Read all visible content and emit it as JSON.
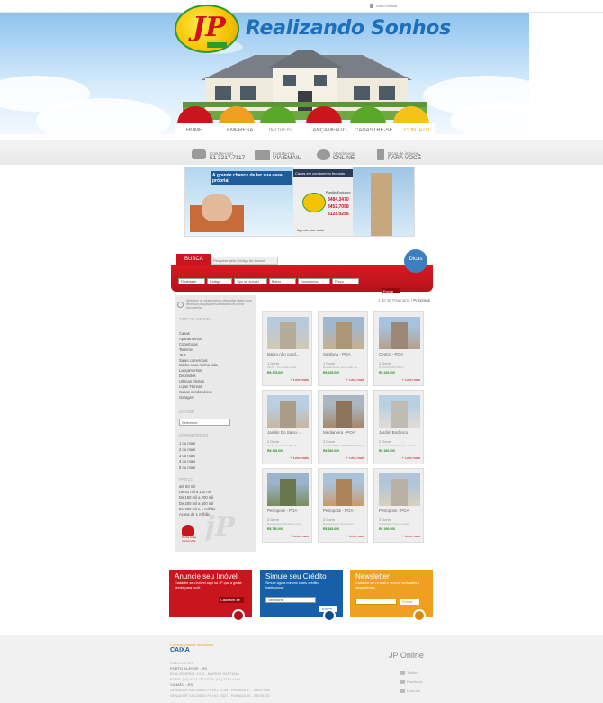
{
  "topbar": {
    "link": "Área Restrita"
  },
  "header": {
    "logo": "JP",
    "slogan": "Realizando Sonhos"
  },
  "nav": [
    "HOME",
    "EMPRESA",
    "IMÓVEIS",
    "LANÇAMENTO",
    "CADASTRE-SE",
    "CONTATO"
  ],
  "contacts": [
    {
      "small": "Contate-nos!",
      "big": "51 3217.7117"
    },
    {
      "small": "Contate-nos",
      "big": "VIA EMAIL"
    },
    {
      "small": "Atendimento",
      "big": "ONLINE"
    },
    {
      "small": "Dicas de imóveis",
      "big": "PARA VOCÊ"
    }
  ],
  "banner": {
    "headline": "A grande chance de ter sua casa própria!",
    "tagline": "Casas em condomínio fechado",
    "phone_label": "Plantão Exclusivo",
    "phones": [
      "3484.3470",
      "3452.7098",
      "3128.0256"
    ],
    "footer": "Agende sua visita"
  },
  "search": {
    "tab": "BUSCA",
    "placeholder": "Pesquise pelo Código do imóvel",
    "dicas": "Dicas",
    "selects": [
      "Finalidade",
      "Código",
      "Tipo de imóvel",
      "Bairro",
      "Dormitórios",
      "Preço"
    ],
    "submit": "Enviar"
  },
  "sidebar": {
    "intro": "Selecione as características desejadas abaixo para filtrar sua pesquisa personalizada com outros documentos",
    "types_head": "TIPO DE IMÓVEL",
    "types": [
      "Casas",
      "Apartamentos",
      "Coberturas",
      "Terrenos",
      "JK's",
      "Salas comerciais",
      "Minha casa minha vida",
      "Lançamentos",
      "Depósitos",
      "Ultimas ofertas",
      "Lojas Térreas",
      "Casas condomínios",
      "Garagem"
    ],
    "city_head": "CIDADE",
    "city_select": "Selecione",
    "rooms_head": "DORMITÓRIOS",
    "rooms": [
      "1 ou mais",
      "2 ou mais",
      "3 ou mais",
      "4 ou mais",
      "5 ou mais"
    ],
    "price_head": "PREÇO",
    "prices": [
      "até 50 mil",
      "De 51 mil a 150 mil",
      "De 150 mil a 200 mil",
      "De 200 mil a 400 mil",
      "De 400 mil a 1 milhão",
      "Acima de 1 milhão"
    ],
    "badge": "Minha Casa Minha Vida",
    "watermark": "jP"
  },
  "pager": {
    "text": "1 de 30 Página(s) |",
    "next": "Próximas"
  },
  "listings": [
    {
      "title": "Bairro não cand...",
      "dorms": "1 Dorm",
      "addr": "Minha - Tumbuteiros-dis",
      "price": "R$ 175.000",
      "more": "+ Leia mais"
    },
    {
      "title": "Sarduna - POA",
      "dorms": "1 Dorm",
      "addr": "Residência do outro lado na...",
      "price": "R$ 135.000",
      "more": "+ Leia mais"
    },
    {
      "title": "Centro - POA",
      "dorms": "2 Dorm",
      "addr": "R. ALVES 320 APTO",
      "price": "R$ 245.000",
      "more": "+ Leia mais"
    },
    {
      "title": "Jardim Do Salso -...",
      "dorms": "2 Dorm",
      "addr": "Minha vista Cheio Brasil",
      "price": "R$ 115.000",
      "more": "+ Leia mais"
    },
    {
      "title": "Medianeira - POA",
      "dorms": "3 Dorm",
      "addr": "EXCELENTE COBERTURA DE 3",
      "price": "R$ 330.000",
      "more": "+ Leia mais"
    },
    {
      "title": "Jardim Botânico",
      "dorms": "2 Dorm",
      "addr": "Residencial do Bosque Jardim",
      "price": "R$ 160.000",
      "more": "+ Leia mais"
    },
    {
      "title": "Petrópolis - POA",
      "dorms": "3 Dorm",
      "addr": "Residencial Grandioso 3 do...",
      "price": "R$ 780.000",
      "more": "+ Leia mais"
    },
    {
      "title": "Petrópolis - POA",
      "dorms": "3 Dorm",
      "addr": "Residencial 3 dormitórios 1",
      "price": "R$ 345.000",
      "more": "+ Leia mais"
    },
    {
      "title": "Petrópolis - POA",
      "dorms": "3 Dorm",
      "addr": "Sofisticado 3 Dorm Vista",
      "price": "R$ 190.000",
      "more": "+ Leia mais"
    }
  ],
  "promos": [
    {
      "title": "Anuncie seu Imóvel",
      "text": "Cadastre seu imóvel aqui na JP que a gente vende para você.",
      "button": "Cadastre-se"
    },
    {
      "title": "Simule seu Crédito",
      "text": "Simule agora mesmo o seu crédito habitacional.",
      "select": "Selecione",
      "button": "Enviar"
    },
    {
      "title": "Newsletter",
      "text": "Cadastre seu e-mail e receba novidades e lançamentos.",
      "button": "Enviar"
    }
  ],
  "footer": {
    "partner_label": "Correspondente Imobiliário",
    "partner": "CAIXA",
    "creci": "CRECI 22.370",
    "offices": [
      {
        "city": "PORTO ALEGRE - RS",
        "lines": [
          "RUA GENERAL 1072 - BAIRRO SANTANA",
          "FONE: (51) 3217.7117 FAX: (51) 3217.4414"
        ]
      },
      {
        "city": "VIAMÃO - RS",
        "lines": [
          "SENADOR SALGADO FILHO, 3734 - PARADA 37 - 34937008",
          "SENADOR SALGADO FILHO, 3321 - PARADA 40 - 34935470"
        ]
      }
    ],
    "online_title": "JP Online",
    "social": [
      "Twitter",
      "Facebook",
      "LinkedIn"
    ]
  },
  "colors": {
    "red": "#c9151d",
    "blue": "#1560a8",
    "orange": "#f0a020",
    "green": "#5aa827"
  }
}
